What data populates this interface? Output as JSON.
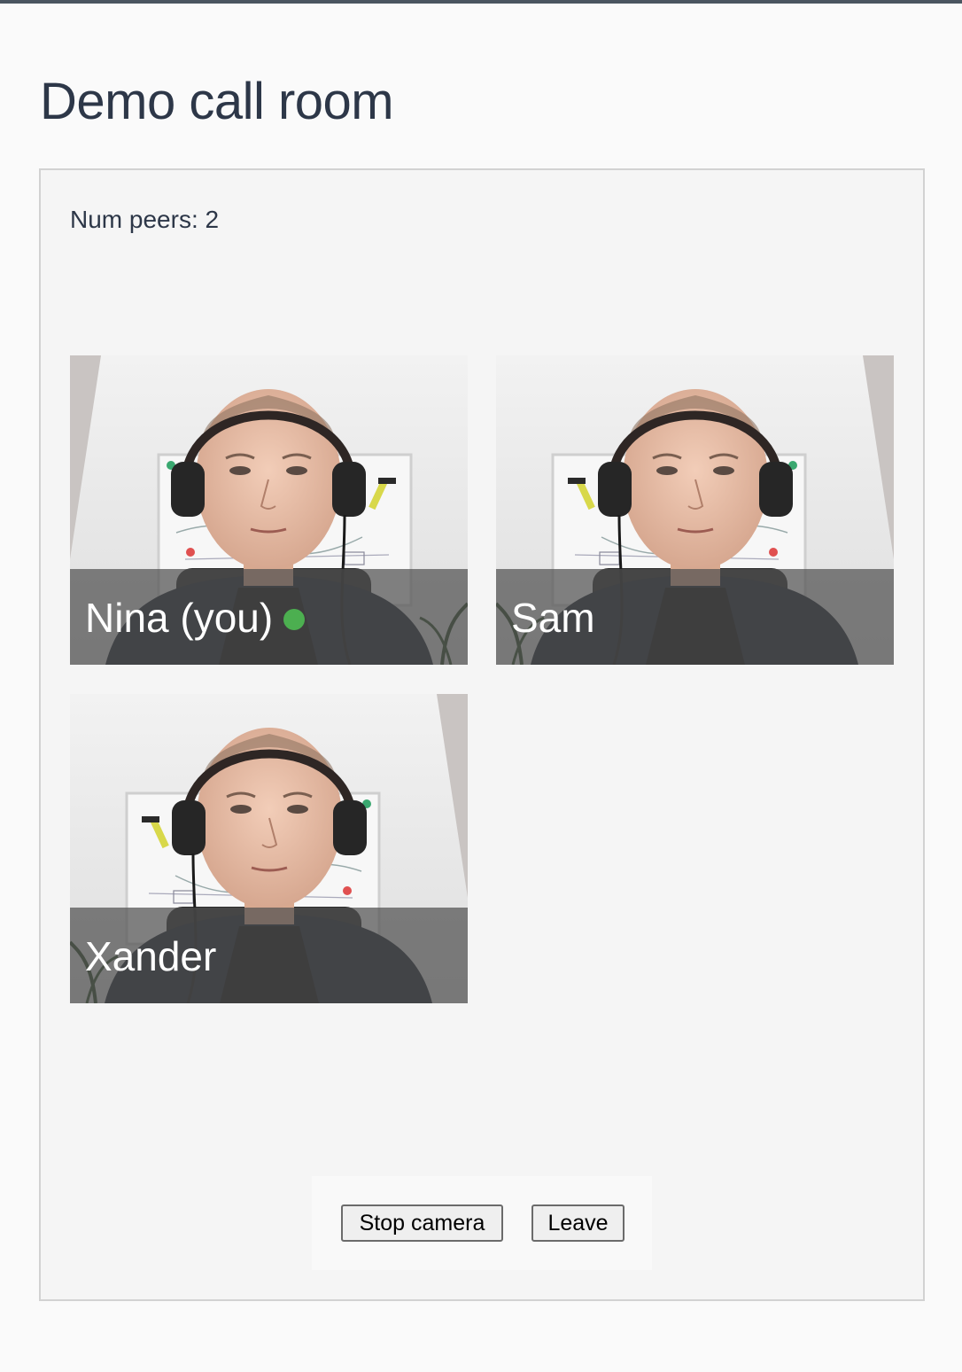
{
  "page": {
    "title": "Demo call room"
  },
  "room": {
    "peers_text": "Num peers: 2"
  },
  "participants": [
    {
      "name": "Nina (you)",
      "is_self": true,
      "speaking": true
    },
    {
      "name": "Sam",
      "is_self": false,
      "speaking": false
    },
    {
      "name": "Xander",
      "is_self": false,
      "speaking": false
    }
  ],
  "controls": {
    "stop_camera_label": "Stop camera",
    "leave_label": "Leave"
  },
  "colors": {
    "speaking_indicator": "#4caf50",
    "title_text": "#2d3748",
    "room_background": "#f5f5f5",
    "name_overlay": "rgba(80,80,80,0.72)"
  }
}
